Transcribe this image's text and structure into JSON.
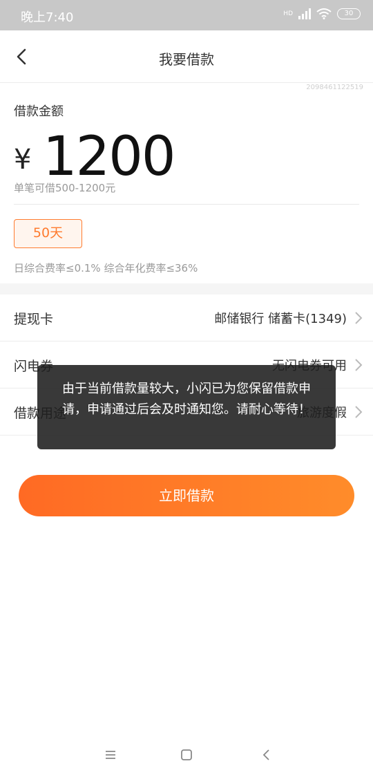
{
  "status": {
    "time": "晚上7:40",
    "battery": "30",
    "network": "HD"
  },
  "header": {
    "title": "我要借款"
  },
  "order_id": "2098461122519",
  "loan": {
    "amount_label": "借款金额",
    "currency_symbol": "¥",
    "amount": "1200",
    "range_text": "单笔可借500-1200元",
    "term_label": "50天",
    "rate_text": "日综合费率≤0.1% 综合年化费率≤36%"
  },
  "rows": [
    {
      "label": "提现卡",
      "value": "邮储银行 储蓄卡(1349)"
    },
    {
      "label": "闪电券",
      "value": "无闪电券可用"
    },
    {
      "label": "借款用途",
      "value": "旅游度假"
    }
  ],
  "cta_label": "立即借款",
  "toast_text": "由于当前借款量较大，小闪已为您保留借款申请，申请通过后会及时通知您。请耐心等待！",
  "colors": {
    "accent": "#ff7b2e",
    "cta_start": "#ff6a24",
    "cta_end": "#ff8c2a"
  }
}
